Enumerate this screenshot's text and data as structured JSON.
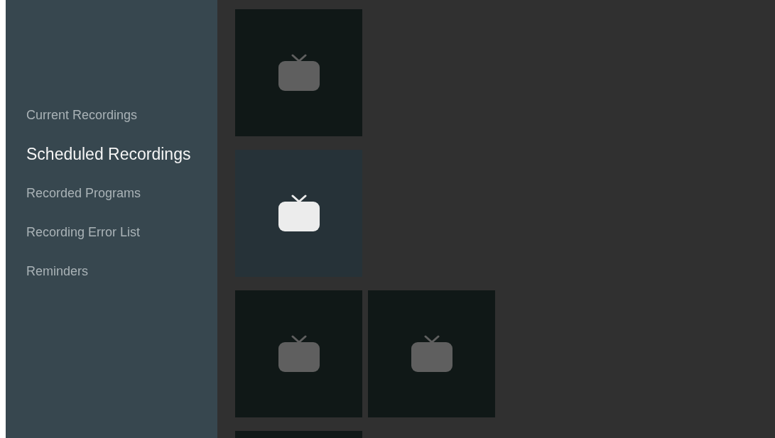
{
  "sidebar": {
    "items": [
      {
        "label": "Current Recordings",
        "selected": false
      },
      {
        "label": "Scheduled Recordings",
        "selected": true
      },
      {
        "label": "Recorded Programs",
        "selected": false
      },
      {
        "label": "Recording Error List",
        "selected": false
      },
      {
        "label": "Reminders",
        "selected": false
      }
    ]
  },
  "grid": {
    "rows": [
      {
        "tiles": [
          {
            "selected": false
          }
        ]
      },
      {
        "tiles": [
          {
            "selected": true
          }
        ]
      },
      {
        "tiles": [
          {
            "selected": false
          },
          {
            "selected": false
          }
        ]
      },
      {
        "tiles": [
          {
            "selected": false
          }
        ]
      }
    ]
  }
}
